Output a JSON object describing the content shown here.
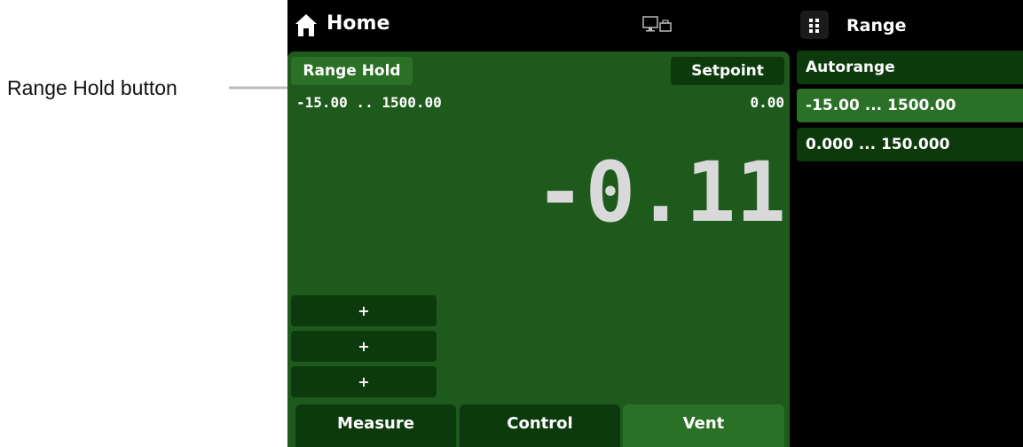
{
  "annotation": {
    "label": "Range Hold button"
  },
  "header": {
    "title": "Home",
    "right_title": "Range"
  },
  "main": {
    "range_hold_label": "Range Hold",
    "setpoint_label": "Setpoint",
    "range_text": "-15.00 .. 1500.00",
    "setpoint_value": "0.00",
    "reading": "-0.11",
    "plus_buttons": [
      "+",
      "+",
      "+"
    ]
  },
  "tabs": [
    {
      "label": "Measure",
      "active": false
    },
    {
      "label": "Control",
      "active": false
    },
    {
      "label": "Vent",
      "active": true
    }
  ],
  "range_panel": {
    "items": [
      {
        "label": "Autorange",
        "selected": false
      },
      {
        "label": "-15.00 ... 1500.00",
        "selected": true
      },
      {
        "label": "0.000 ... 150.000",
        "selected": false
      }
    ]
  },
  "colors": {
    "panel_green": "#1e5a1c",
    "dark_green": "#0d3a0d",
    "light_green": "#2a7026",
    "background": "#000000"
  }
}
